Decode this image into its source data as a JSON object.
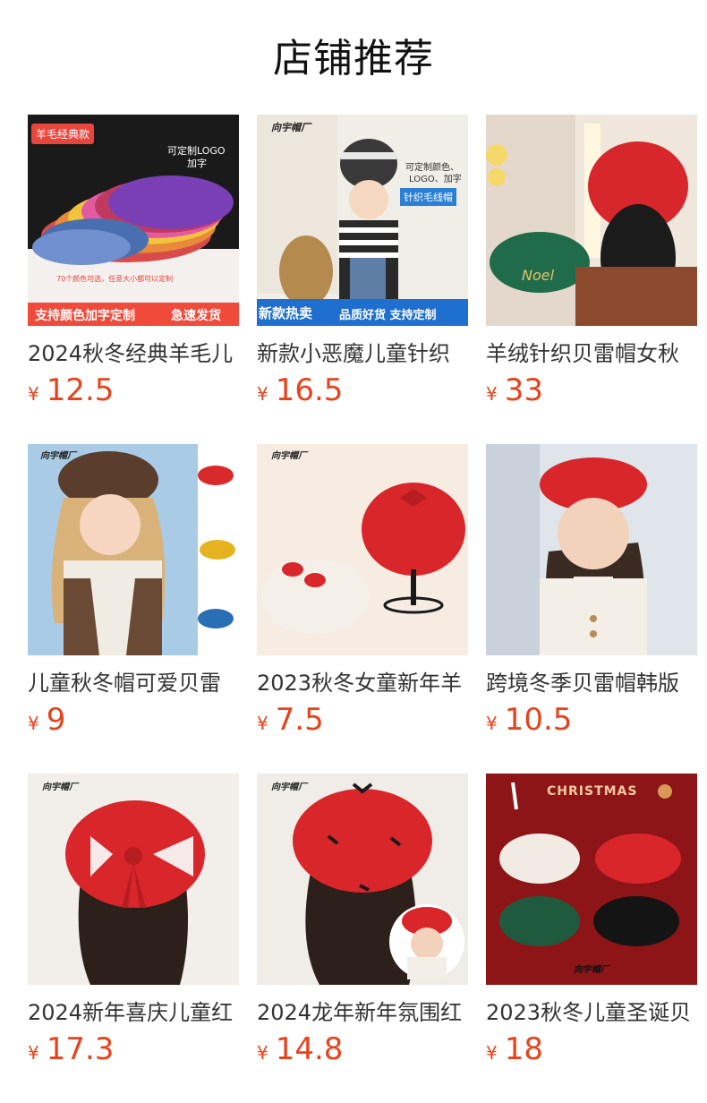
{
  "header": {
    "title": "店铺推荐"
  },
  "currency": "¥",
  "colors": {
    "price": "#e6431c"
  },
  "products": [
    {
      "name": "2024秋冬经典羊毛儿",
      "price": "12.5",
      "badges": [
        "羊毛经典款",
        "可定制LOGO",
        "加字",
        "70个颜色可选，任意大小都可以定制",
        "支持颜色加字定制",
        "急速发货"
      ]
    },
    {
      "name": "新款小恶魔儿童针织",
      "price": "16.5",
      "badges": [
        "向宇帽厂",
        "可定制颜色、",
        "LOGO、加字",
        "针织毛线帽",
        "新款热卖",
        "品质好货 支持定制"
      ]
    },
    {
      "name": "羊绒针织贝雷帽女秋",
      "price": "33",
      "badges": [
        "Noel"
      ]
    },
    {
      "name": "儿童秋冬帽可爱贝雷",
      "price": "9",
      "badges": [
        "向宇帽厂"
      ]
    },
    {
      "name": "2023秋冬女童新年羊",
      "price": "7.5",
      "badges": [
        "向宇帽厂"
      ]
    },
    {
      "name": "跨境冬季贝雷帽韩版",
      "price": "10.5",
      "badges": []
    },
    {
      "name": "2024新年喜庆儿童红",
      "price": "17.3",
      "badges": [
        "向宇帽厂"
      ]
    },
    {
      "name": "2024龙年新年氛围红",
      "price": "14.8",
      "badges": [
        "向宇帽厂"
      ]
    },
    {
      "name": "2023秋冬儿童圣诞贝",
      "price": "18",
      "badges": [
        "CHRISTMAS",
        "向宇帽厂"
      ]
    }
  ]
}
